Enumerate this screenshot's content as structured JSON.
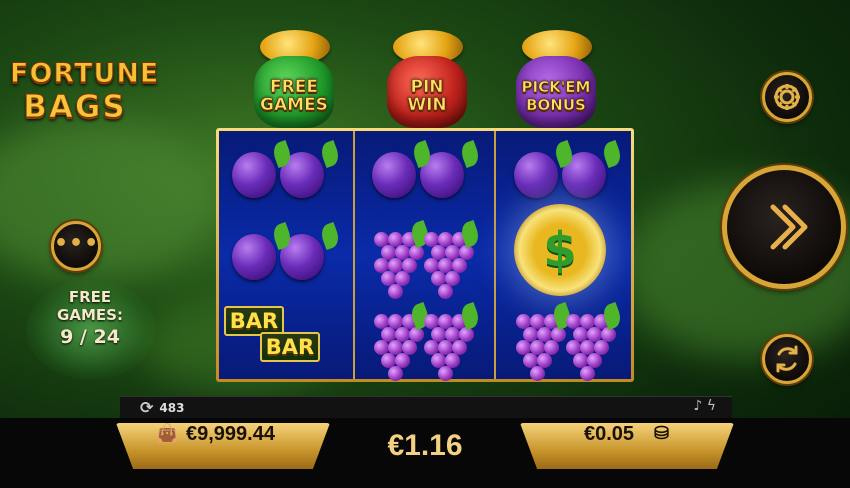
{
  "game": {
    "logo_line1": "FORTUNE",
    "logo_line2": "BAGS"
  },
  "bonus_bags": [
    {
      "name": "bag-free-games",
      "line1": "FREE",
      "line2": "GAMES",
      "color": "#1f9a2a"
    },
    {
      "name": "bag-pin-win",
      "line1": "PIN",
      "line2": "WIN",
      "color": "#c0221c"
    },
    {
      "name": "bag-pick-em-bonus",
      "line1": "PICK'EM",
      "line2": "BONUS",
      "color": "#7a2fb0"
    }
  ],
  "reels": {
    "symbols": [
      [
        "plum",
        "plum",
        "bar-bar"
      ],
      [
        "plum",
        "grapes",
        "grapes"
      ],
      [
        "plum",
        "dollar-coin",
        "grapes"
      ]
    ],
    "coin_symbol": "$",
    "bar_label": "BAR"
  },
  "free_games": {
    "label_line1": "FREE",
    "label_line2": "GAMES:",
    "counter": "9 / 24"
  },
  "status_strip": {
    "autospin_icon": "refresh-icon",
    "spins_count": "483",
    "music_icon": "music-note-icon",
    "turbo_icon": "lightning-icon"
  },
  "balance": {
    "icon": "wallet-icon",
    "value": "€9,999.44"
  },
  "win": {
    "value": "€1.16"
  },
  "bet": {
    "value": "€0.05",
    "icon": "coin-stack-icon"
  },
  "buttons": {
    "menu_icon": "more-dots-icon",
    "settings_icon": "gear-icon",
    "spin_icon": "double-chevron-right-icon",
    "autoplay_icon": "autoplay-icon"
  },
  "colors": {
    "gold": "#d7a637",
    "reel_blue": "#0a2aa8",
    "background_green": "#1d4a14"
  }
}
